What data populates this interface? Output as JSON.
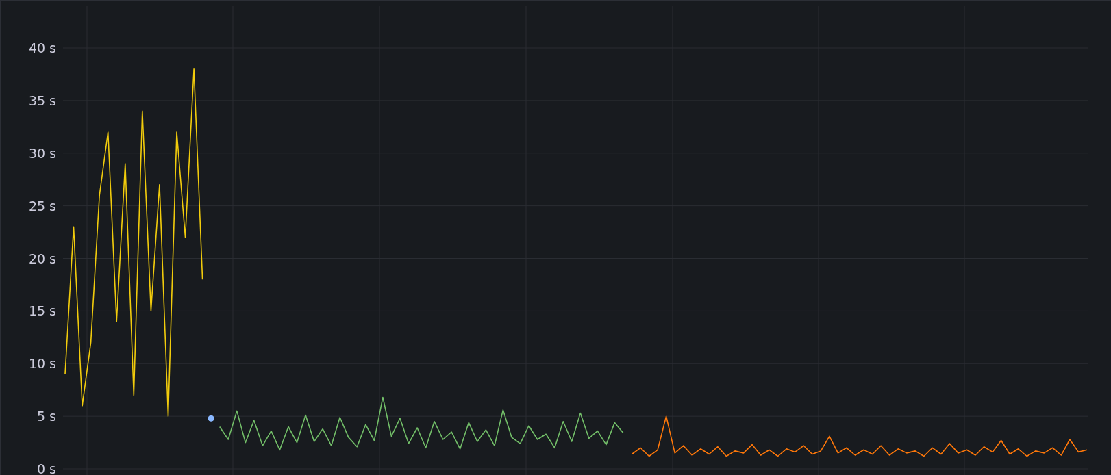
{
  "panel": {
    "chart_data": {
      "type": "line",
      "grid": true,
      "ylim": [
        0,
        40
      ],
      "yticks": [
        {
          "value": 0,
          "label": "0 s"
        },
        {
          "value": 5,
          "label": "5 s"
        },
        {
          "value": 10,
          "label": "10 s"
        },
        {
          "value": 15,
          "label": "15 s"
        },
        {
          "value": 20,
          "label": "20 s"
        },
        {
          "value": 25,
          "label": "25 s"
        },
        {
          "value": 30,
          "label": "30 s"
        },
        {
          "value": 35,
          "label": "35 s"
        },
        {
          "value": 40,
          "label": "40 s"
        }
      ],
      "series": [
        {
          "color": "#f2cc0c",
          "values": [
            9,
            23,
            6,
            12,
            26,
            32,
            14,
            29,
            7,
            34,
            15,
            27,
            5,
            32,
            22,
            38,
            18,
            null,
            null,
            null,
            null,
            null,
            null,
            null,
            null,
            null,
            null,
            null,
            null,
            null,
            null,
            null,
            null,
            null,
            null,
            null,
            null,
            null,
            null,
            null,
            null,
            null,
            null,
            null,
            null,
            null,
            null,
            null,
            null,
            null,
            null,
            null,
            null,
            null,
            null,
            null,
            null,
            null,
            null,
            null,
            null,
            null,
            null,
            null,
            null,
            null,
            null,
            null,
            null,
            null,
            null,
            null,
            null,
            null,
            null,
            null,
            null,
            null,
            null,
            null,
            null,
            null,
            null,
            null,
            null,
            null,
            null,
            null,
            null,
            null,
            null,
            null,
            null,
            null,
            null,
            null,
            null,
            null,
            null,
            null,
            null,
            null,
            null,
            null,
            null,
            null,
            null,
            null,
            null,
            null,
            null,
            null,
            null,
            null,
            null,
            null,
            null,
            null,
            null,
            null
          ]
        },
        {
          "color": "#8ab8ff",
          "marker": true,
          "values": [
            null,
            null,
            null,
            null,
            null,
            null,
            null,
            null,
            null,
            null,
            null,
            null,
            null,
            null,
            null,
            null,
            null,
            4.8,
            null,
            null,
            null,
            null,
            null,
            null,
            null,
            null,
            null,
            null,
            null,
            null,
            null,
            null,
            null,
            null,
            null,
            null,
            null,
            null,
            null,
            null,
            null,
            null,
            null,
            null,
            null,
            null,
            null,
            null,
            null,
            null,
            null,
            null,
            null,
            null,
            null,
            null,
            null,
            null,
            null,
            null,
            null,
            null,
            null,
            null,
            null,
            null,
            null,
            null,
            null,
            null,
            null,
            null,
            null,
            null,
            null,
            null,
            null,
            null,
            null,
            null,
            null,
            null,
            null,
            null,
            null,
            null,
            null,
            null,
            null,
            null,
            null,
            null,
            null,
            null,
            null,
            null,
            null,
            null,
            null,
            null,
            null,
            null,
            null,
            null,
            null,
            null,
            null,
            null,
            null,
            null,
            null,
            null,
            null,
            null,
            null,
            null,
            null,
            null,
            null,
            null
          ]
        },
        {
          "color": "#73bf69",
          "values": [
            null,
            null,
            null,
            null,
            null,
            null,
            null,
            null,
            null,
            null,
            null,
            null,
            null,
            null,
            null,
            null,
            null,
            null,
            4,
            2.8,
            5.5,
            2.5,
            4.6,
            2.2,
            3.6,
            1.8,
            4,
            2.5,
            5.1,
            2.6,
            3.8,
            2.2,
            4.9,
            3,
            2.1,
            4.2,
            2.7,
            6.8,
            3.1,
            4.8,
            2.4,
            3.9,
            2,
            4.5,
            2.8,
            3.5,
            1.9,
            4.4,
            2.6,
            3.7,
            2.2,
            5.6,
            3,
            2.4,
            4.1,
            2.8,
            3.3,
            2,
            4.5,
            2.6,
            5.3,
            2.9,
            3.6,
            2.3,
            4.4,
            3.4,
            null,
            null,
            null,
            null,
            null,
            null,
            null,
            null,
            null,
            null,
            null,
            null,
            null,
            null,
            null,
            null,
            null,
            null,
            null,
            null,
            null,
            null,
            null,
            null,
            null,
            null,
            null,
            null,
            null,
            null,
            null,
            null,
            null,
            null,
            null,
            null,
            null,
            null,
            null,
            null,
            null,
            null,
            null,
            null,
            null,
            null,
            null,
            null,
            null,
            null,
            null,
            null,
            null,
            null
          ]
        },
        {
          "color": "#ff780a",
          "values": [
            null,
            null,
            null,
            null,
            null,
            null,
            null,
            null,
            null,
            null,
            null,
            null,
            null,
            null,
            null,
            null,
            null,
            null,
            null,
            null,
            null,
            null,
            null,
            null,
            null,
            null,
            null,
            null,
            null,
            null,
            null,
            null,
            null,
            null,
            null,
            null,
            null,
            null,
            null,
            null,
            null,
            null,
            null,
            null,
            null,
            null,
            null,
            null,
            null,
            null,
            null,
            null,
            null,
            null,
            null,
            null,
            null,
            null,
            null,
            null,
            null,
            null,
            null,
            null,
            null,
            null,
            1.4,
            2,
            1.2,
            1.8,
            5,
            1.5,
            2.2,
            1.3,
            1.9,
            1.4,
            2.1,
            1.2,
            1.7,
            1.5,
            2.3,
            1.3,
            1.8,
            1.2,
            1.9,
            1.6,
            2.2,
            1.4,
            1.7,
            3.1,
            1.5,
            2,
            1.3,
            1.8,
            1.4,
            2.2,
            1.3,
            1.9,
            1.5,
            1.7,
            1.2,
            2,
            1.4,
            2.4,
            1.5,
            1.8,
            1.3,
            2.1,
            1.6,
            2.7,
            1.4,
            1.9,
            1.2,
            1.7,
            1.5,
            2,
            1.3,
            2.8,
            1.6,
            1.8
          ]
        }
      ]
    }
  }
}
